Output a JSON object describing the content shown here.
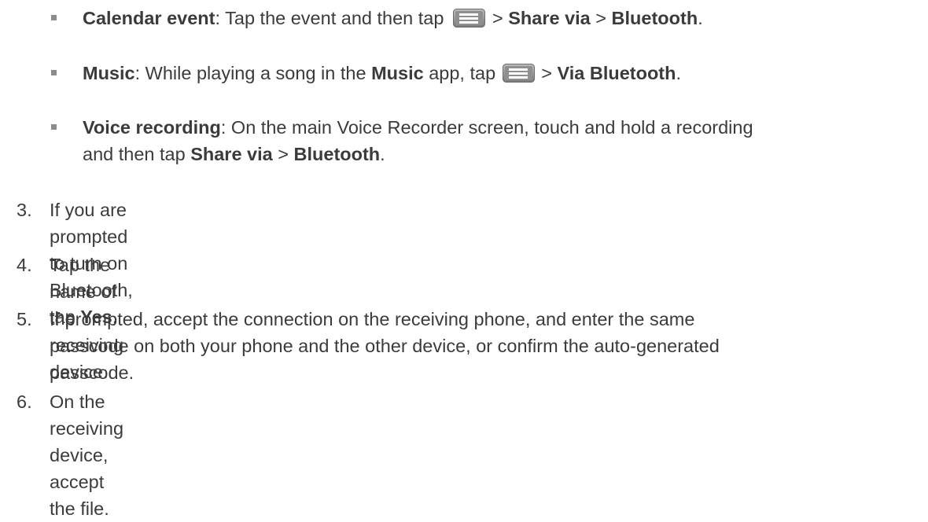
{
  "bullets": [
    {
      "label": "Calendar event",
      "text1": ": Tap the event and then tap",
      "sep1": " > ",
      "bold1": "Share via",
      "sep2": " > ",
      "bold2": "Bluetooth",
      "end": "."
    },
    {
      "label": "Music",
      "text1": ": While playing a song in the ",
      "bold_app": "Music",
      "text2": " app, tap ",
      "sep1": " > ",
      "bold1": "Via Bluetooth",
      "end": "."
    },
    {
      "label": "Voice recording",
      "line1": ": On the main Voice Recorder screen, touch and hold a recording",
      "line2": "and then tap ",
      "bold1": "Share via",
      "sep1": " > ",
      "bold2": "Bluetooth",
      "end": "."
    }
  ],
  "steps": [
    {
      "number": "3.",
      "text": "If you are prompted to turn on Bluetooth, tap ",
      "bold": "Yes",
      "end": "."
    },
    {
      "number": "4.",
      "text": "Tap the name of the receiving device."
    },
    {
      "number": "5.",
      "line1": "If prompted, accept the connection on the receiving phone, and enter the same",
      "line2": "passcode on both your phone and the other device, or confirm the auto-generated",
      "line3": "passcode."
    },
    {
      "number": "6.",
      "text": "On the receiving device, accept the file."
    }
  ],
  "icons": {
    "menu": "menu-icon"
  },
  "colors": {
    "text": "#3b3b3b",
    "bullet": "#8c8c8c"
  }
}
